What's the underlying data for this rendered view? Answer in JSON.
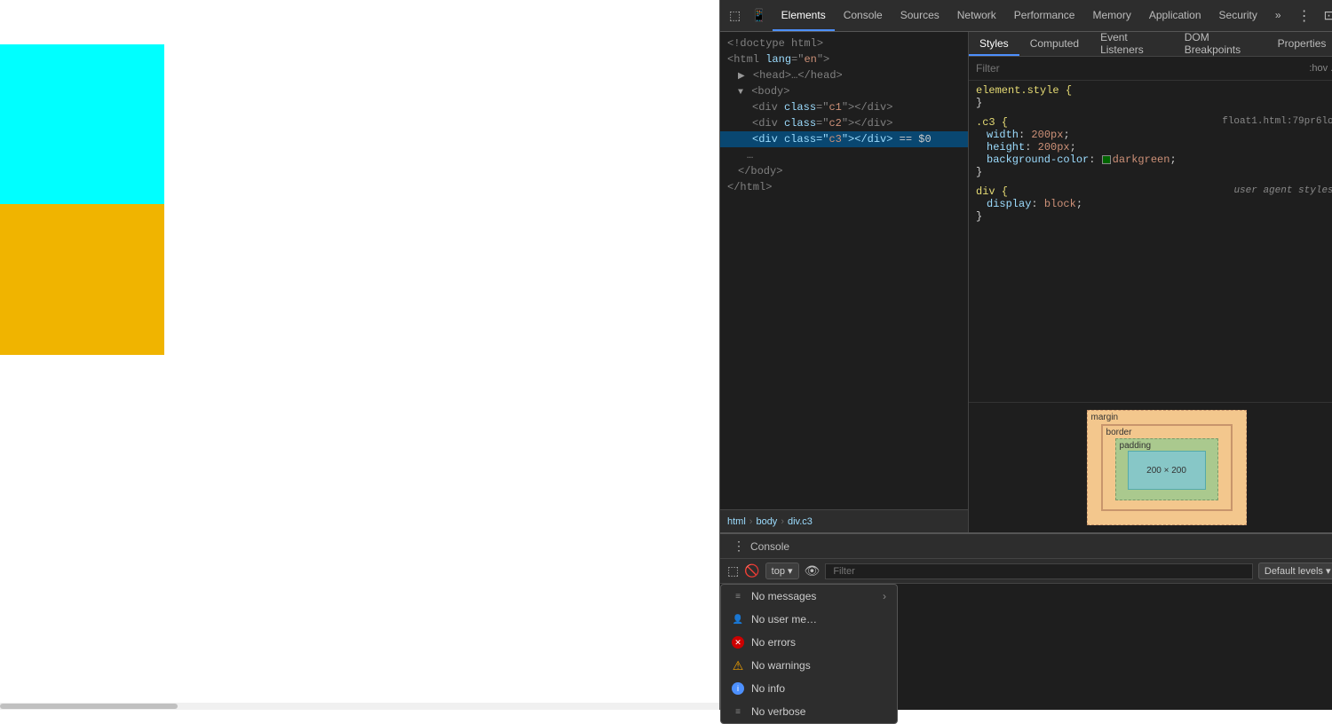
{
  "viewport": {
    "cyan_box": "cyan",
    "yellow_box": "#f0b400"
  },
  "devtools": {
    "toolbar": {
      "icons": [
        "☰",
        "⟳"
      ],
      "more_label": "»",
      "dock_label": "⋮",
      "close_label": "✕"
    },
    "tabs": [
      {
        "label": "Elements",
        "active": true
      },
      {
        "label": "Console",
        "active": false
      },
      {
        "label": "Sources",
        "active": false
      },
      {
        "label": "Network",
        "active": false
      },
      {
        "label": "Performance",
        "active": false
      },
      {
        "label": "Memory",
        "active": false
      },
      {
        "label": "Application",
        "active": false
      },
      {
        "label": "Security",
        "active": false
      }
    ],
    "dom": {
      "lines": [
        {
          "text": "<!doctype html>",
          "indent": 0,
          "type": "doctype"
        },
        {
          "text": "<html lang=\"en\">",
          "indent": 0,
          "type": "open"
        },
        {
          "text": "▶ <head>…</head>",
          "indent": 1,
          "type": "collapsed"
        },
        {
          "text": "▼ <body>",
          "indent": 1,
          "type": "open"
        },
        {
          "text": "<div class=\"c1\"></div>",
          "indent": 2,
          "type": "element"
        },
        {
          "text": "<div class=\"c2\"></div>",
          "indent": 2,
          "type": "element"
        },
        {
          "text": "<div class=\"c3\"></div> == $0",
          "indent": 2,
          "type": "element",
          "selected": true
        },
        {
          "text": "</body>",
          "indent": 1,
          "type": "close"
        },
        {
          "text": "</html>",
          "indent": 0,
          "type": "close"
        }
      ]
    },
    "breadcrumb": {
      "items": [
        {
          "label": "html"
        },
        {
          "label": "body"
        },
        {
          "label": "div.c3"
        }
      ]
    },
    "styles": {
      "tabs": [
        {
          "label": "Styles",
          "active": true
        },
        {
          "label": "Computed",
          "active": false
        },
        {
          "label": "Event Listeners",
          "active": false
        },
        {
          "label": "DOM Breakpoints",
          "active": false
        },
        {
          "label": "Properties",
          "active": false
        }
      ],
      "filter_placeholder": "Filter",
      "filter_options": ":hov .cls",
      "rules": [
        {
          "selector": "element.style {",
          "source": "",
          "props": [],
          "close": "}"
        },
        {
          "selector": ".c3 {",
          "source": "float1.html:79",
          "props": [
            {
              "name": "width",
              "value": "200px"
            },
            {
              "name": "height",
              "value": "200px"
            },
            {
              "name": "background-color",
              "value": "darkgreen",
              "has_swatch": true,
              "swatch_color": "darkgreen"
            }
          ],
          "close": "}"
        },
        {
          "selector": "div {",
          "source": "user agent stylesheet",
          "props": [
            {
              "name": "display",
              "value": "block"
            }
          ],
          "close": "}"
        }
      ],
      "box_model": {
        "margin_label": "margin",
        "border_label": "border",
        "padding_label": "padding",
        "content_size": "200 × 200"
      }
    }
  },
  "console": {
    "title": "Console",
    "context": "top",
    "filter_placeholder": "Filter",
    "level_label": "Default levels ▾",
    "dropdown": {
      "items": [
        {
          "icon": "≡",
          "icon_type": "messages",
          "label": "No messages",
          "has_arrow": true
        },
        {
          "icon": "👤",
          "icon_type": "user",
          "label": "No user me…"
        },
        {
          "icon": "✕",
          "icon_type": "error",
          "label": "No errors"
        },
        {
          "icon": "⚠",
          "icon_type": "warning",
          "label": "No warnings"
        },
        {
          "icon": "ℹ",
          "icon_type": "info",
          "label": "No info"
        },
        {
          "icon": "≡",
          "icon_type": "verbose",
          "label": "No verbose"
        }
      ]
    }
  }
}
